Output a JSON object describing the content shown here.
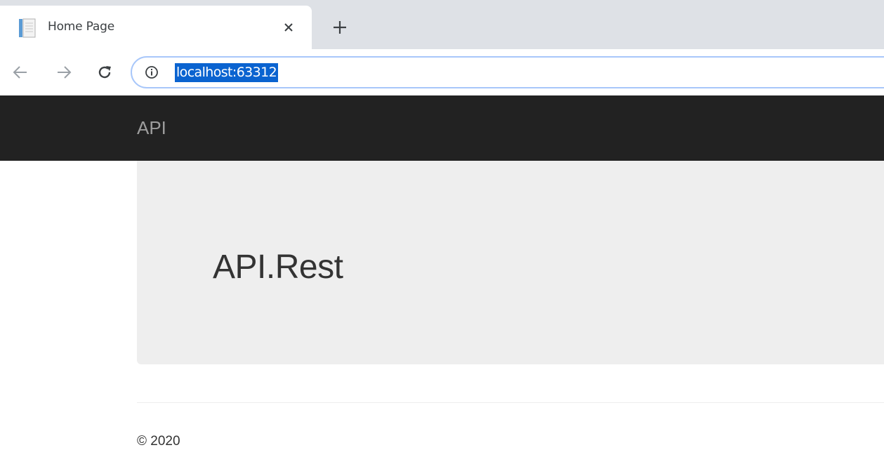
{
  "browser": {
    "tab": {
      "title": "Home Page",
      "favicon_icon": "document-icon",
      "close_icon": "close-icon"
    },
    "new_tab_icon": "plus-icon",
    "nav": {
      "back_icon": "arrow-left-icon",
      "forward_icon": "arrow-right-icon",
      "reload_icon": "reload-icon"
    },
    "omnibox": {
      "info_icon": "info-icon",
      "url": "localhost:63312",
      "url_selected": true,
      "selection_color": "#0a63d0"
    }
  },
  "page": {
    "navbar": {
      "brand": "API",
      "background": "#222222"
    },
    "jumbotron": {
      "title": "API.Rest",
      "background": "#eeeeee"
    },
    "footer": {
      "text": "© 2020"
    }
  }
}
